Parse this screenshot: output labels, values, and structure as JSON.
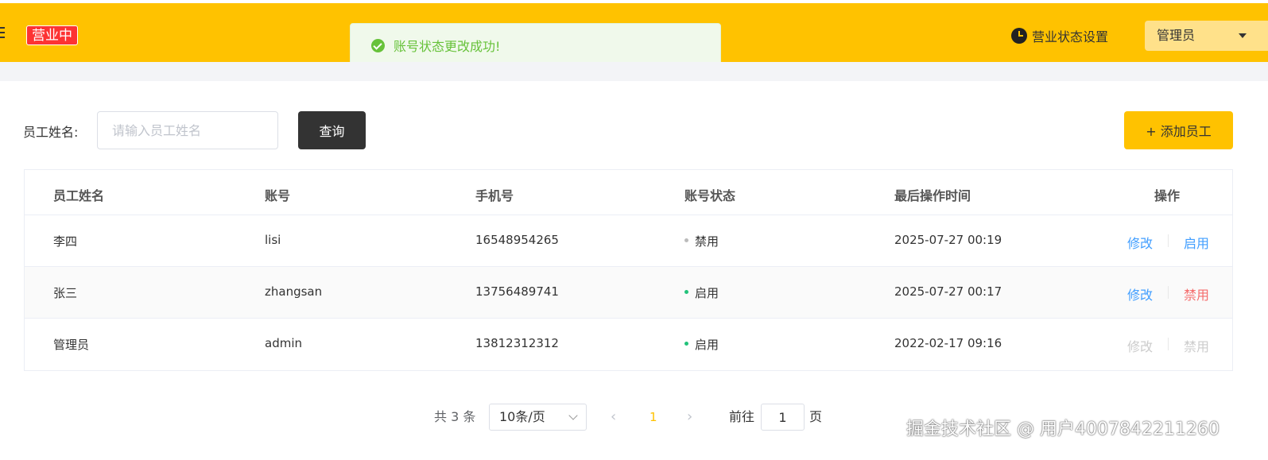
{
  "header": {
    "status_badge": "营业中",
    "biz_setting_label": "营业状态设置",
    "user_name": "管理员"
  },
  "toast": {
    "message": "账号状态更改成功!"
  },
  "search": {
    "label": "员工姓名:",
    "placeholder": "请输入员工姓名",
    "query_label": "查询",
    "add_label": "+ 添加员工"
  },
  "table": {
    "columns": [
      "员工姓名",
      "账号",
      "手机号",
      "账号状态",
      "最后操作时间",
      "操作"
    ],
    "rows": [
      {
        "name": "李四",
        "account": "lisi",
        "phone": "16548954265",
        "status": "禁用",
        "time": "2025-07-27 00:19",
        "edit": "修改",
        "toggle": "启用"
      },
      {
        "name": "张三",
        "account": "zhangsan",
        "phone": "13756489741",
        "status": "启用",
        "time": "2025-07-27 00:17",
        "edit": "修改",
        "toggle": "禁用"
      },
      {
        "name": "管理员",
        "account": "admin",
        "phone": "13812312312",
        "status": "启用",
        "time": "2022-02-17 09:16",
        "edit": "修改",
        "toggle": "禁用"
      }
    ]
  },
  "pagination": {
    "total": "共 3 条",
    "page_size": "10条/页",
    "prev": "‹",
    "current": "1",
    "next": "›",
    "goto_label": "前往",
    "goto_value": "1",
    "page_label": "页"
  },
  "watermark": "掘金技术社区 @ 用户4007842211260",
  "colors": {
    "brand": "#ffc200",
    "badge": "#fd3333",
    "success": "#67c23a",
    "link": "#419eff",
    "danger": "#f56c6c"
  }
}
